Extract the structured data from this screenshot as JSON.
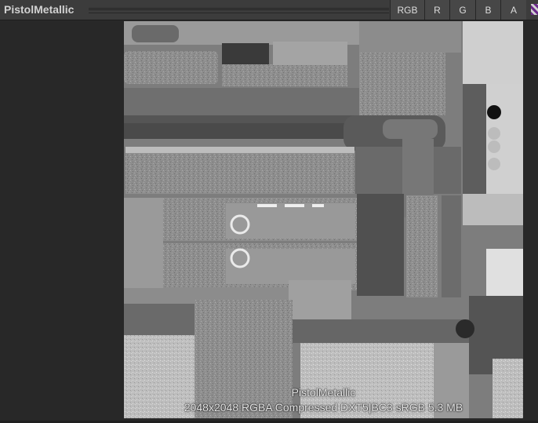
{
  "window": {
    "title": "PistolMetallic"
  },
  "channels": [
    {
      "label": "RGB",
      "icon": ""
    },
    {
      "label": "R"
    },
    {
      "label": "G"
    },
    {
      "label": "B"
    },
    {
      "label": "A"
    }
  ],
  "preview": {
    "name": "PistolMetallic",
    "details": "2048x2048  RGBA Compressed DXT5|BC3 sRGB   5.3 MB"
  },
  "icons": {
    "swatch": "mip-color-swatch-icon"
  }
}
